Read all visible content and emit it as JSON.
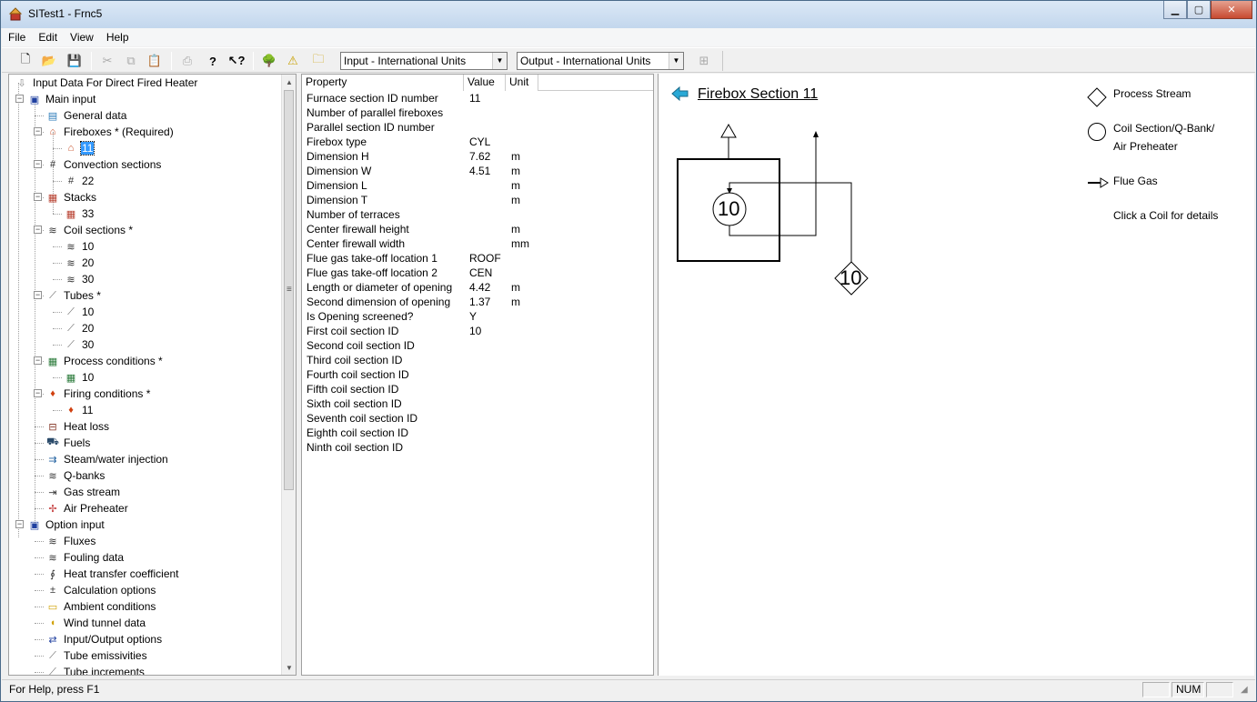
{
  "window": {
    "title": "SITest1 - Frnc5"
  },
  "menu": [
    "File",
    "Edit",
    "View",
    "Help"
  ],
  "toolbar": {
    "input_units": "Input - International Units",
    "output_units": "Output - International Units"
  },
  "tree": [
    {
      "label": "Input Data For Direct Fired Heater",
      "icon": "arrow-icon",
      "level": 0,
      "glyph": "⇩"
    },
    {
      "label": "Main input",
      "icon": "hierarchy-icon",
      "level": 1,
      "exp": "−",
      "glyph": "▣"
    },
    {
      "label": "General data",
      "icon": "general-data-icon",
      "level": 2,
      "glyph": "▤"
    },
    {
      "label": "Fireboxes * (Required)",
      "icon": "firebox-icon",
      "level": 2,
      "exp": "−",
      "glyph": "⌂"
    },
    {
      "label": "11",
      "icon": "firebox-icon",
      "level": 3,
      "glyph": "⌂",
      "selected": true
    },
    {
      "label": "Convection sections",
      "icon": "convection-icon",
      "level": 2,
      "exp": "−",
      "glyph": "#"
    },
    {
      "label": "22",
      "icon": "convection-icon",
      "level": 3,
      "glyph": "#"
    },
    {
      "label": "Stacks",
      "icon": "stack-icon",
      "level": 2,
      "exp": "−",
      "glyph": "▦"
    },
    {
      "label": "33",
      "icon": "stack-icon",
      "level": 3,
      "glyph": "▦"
    },
    {
      "label": "Coil sections *",
      "icon": "coil-icon",
      "level": 2,
      "exp": "−",
      "glyph": "≋"
    },
    {
      "label": "10",
      "icon": "coil-icon",
      "level": 3,
      "glyph": "≋"
    },
    {
      "label": "20",
      "icon": "coil-icon",
      "level": 3,
      "glyph": "≋"
    },
    {
      "label": "30",
      "icon": "coil-icon",
      "level": 3,
      "glyph": "≋"
    },
    {
      "label": "Tubes *",
      "icon": "tube-icon",
      "level": 2,
      "exp": "−",
      "glyph": "⟋"
    },
    {
      "label": "10",
      "icon": "tube-icon",
      "level": 3,
      "glyph": "⟋"
    },
    {
      "label": "20",
      "icon": "tube-icon",
      "level": 3,
      "glyph": "⟋"
    },
    {
      "label": "30",
      "icon": "tube-icon",
      "level": 3,
      "glyph": "⟋"
    },
    {
      "label": "Process conditions *",
      "icon": "process-conditions-icon",
      "level": 2,
      "exp": "−",
      "glyph": "▦"
    },
    {
      "label": "10",
      "icon": "process-conditions-icon",
      "level": 3,
      "glyph": "▦"
    },
    {
      "label": "Firing conditions *",
      "icon": "flame-icon",
      "level": 2,
      "exp": "−",
      "glyph": "♦"
    },
    {
      "label": "11",
      "icon": "flame-icon",
      "level": 3,
      "glyph": "♦"
    },
    {
      "label": "Heat loss",
      "icon": "heat-loss-icon",
      "level": 2,
      "glyph": "⊟"
    },
    {
      "label": "Fuels",
      "icon": "fuel-truck-icon",
      "level": 2,
      "glyph": "⛟"
    },
    {
      "label": "Steam/water injection",
      "icon": "injection-icon",
      "level": 2,
      "glyph": "⇉"
    },
    {
      "label": "Q-banks",
      "icon": "qbank-icon",
      "level": 2,
      "glyph": "≋"
    },
    {
      "label": "Gas stream",
      "icon": "gas-stream-icon",
      "level": 2,
      "glyph": "⇥"
    },
    {
      "label": "Air Preheater",
      "icon": "air-preheater-icon",
      "level": 2,
      "glyph": "✢"
    },
    {
      "label": "Option input",
      "icon": "hierarchy-icon",
      "level": 1,
      "exp": "−",
      "glyph": "▣"
    },
    {
      "label": "Fluxes",
      "icon": "flux-icon",
      "level": 2,
      "glyph": "≋"
    },
    {
      "label": "Fouling data",
      "icon": "fouling-icon",
      "level": 2,
      "glyph": "≋"
    },
    {
      "label": "Heat transfer coefficient",
      "icon": "heat-transfer-icon",
      "level": 2,
      "glyph": "∮"
    },
    {
      "label": "Calculation options",
      "icon": "calculation-icon",
      "level": 2,
      "glyph": "±"
    },
    {
      "label": "Ambient conditions",
      "icon": "ambient-icon",
      "level": 2,
      "glyph": "▭"
    },
    {
      "label": "Wind tunnel data",
      "icon": "wind-tunnel-icon",
      "level": 2,
      "glyph": "◖"
    },
    {
      "label": "Input/Output options",
      "icon": "io-options-icon",
      "level": 2,
      "glyph": "⇄"
    },
    {
      "label": "Tube emissivities",
      "icon": "tube-icon",
      "level": 2,
      "glyph": "⟋"
    },
    {
      "label": "Tube increments",
      "icon": "tube-icon",
      "level": 2,
      "glyph": "⟋"
    }
  ],
  "grid": {
    "headers": [
      "Property",
      "Value",
      "Unit"
    ],
    "rows": [
      {
        "property": "Furnace section ID number",
        "value": "11",
        "unit": ""
      },
      {
        "property": "Number of parallel fireboxes",
        "value": "",
        "unit": ""
      },
      {
        "property": "Parallel section ID number",
        "value": "",
        "unit": ""
      },
      {
        "property": "Firebox type",
        "value": "CYL",
        "unit": ""
      },
      {
        "property": "Dimension H",
        "value": "7.62",
        "unit": "m"
      },
      {
        "property": "Dimension W",
        "value": "4.51",
        "unit": "m"
      },
      {
        "property": "Dimension L",
        "value": "",
        "unit": "m"
      },
      {
        "property": "Dimension T",
        "value": "",
        "unit": "m"
      },
      {
        "property": "Number of terraces",
        "value": "",
        "unit": ""
      },
      {
        "property": "Center firewall height",
        "value": "",
        "unit": "m"
      },
      {
        "property": "Center firewall width",
        "value": "",
        "unit": "mm"
      },
      {
        "property": "Flue gas take-off location 1",
        "value": "ROOF",
        "unit": ""
      },
      {
        "property": "Flue gas take-off location 2",
        "value": "CEN",
        "unit": ""
      },
      {
        "property": "Length or diameter of opening",
        "value": "4.42",
        "unit": "m"
      },
      {
        "property": "Second dimension of opening",
        "value": "1.37",
        "unit": "m"
      },
      {
        "property": "Is Opening screened?",
        "value": "Y",
        "unit": ""
      },
      {
        "property": "First coil section ID",
        "value": "10",
        "unit": ""
      },
      {
        "property": "Second coil section ID",
        "value": "",
        "unit": ""
      },
      {
        "property": "Third coil section ID",
        "value": "",
        "unit": ""
      },
      {
        "property": "Fourth coil section ID",
        "value": "",
        "unit": ""
      },
      {
        "property": "Fifth coil section ID",
        "value": "",
        "unit": ""
      },
      {
        "property": "Sixth coil section ID",
        "value": "",
        "unit": ""
      },
      {
        "property": "Seventh coil section ID",
        "value": "",
        "unit": ""
      },
      {
        "property": "Eighth coil section ID",
        "value": "",
        "unit": ""
      },
      {
        "property": "Ninth coil section ID",
        "value": "",
        "unit": ""
      }
    ]
  },
  "diagram": {
    "title": "Firebox Section 11",
    "coil_label": "10",
    "stream_label": "10",
    "legend": {
      "process_stream": "Process Stream",
      "coil_line1": "Coil Section/Q-Bank/",
      "coil_line2": "Air Preheater",
      "flue_gas": "Flue Gas",
      "hint": "Click a Coil for details"
    }
  },
  "status": {
    "help": "For Help, press F1",
    "num": "NUM"
  }
}
